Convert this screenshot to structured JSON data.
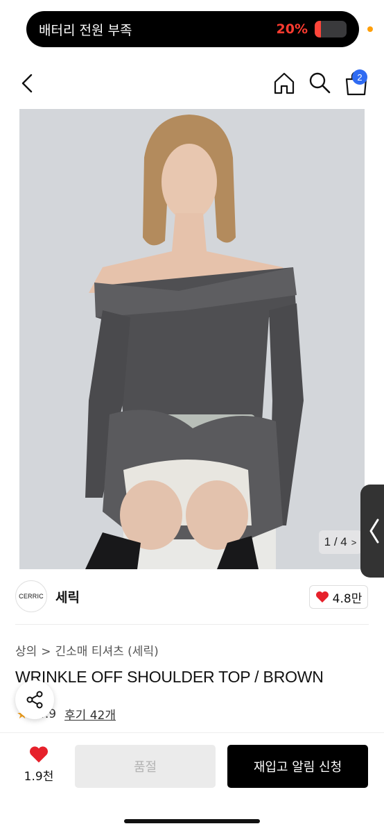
{
  "status": {
    "battery_alert": "배터리 전원 부족",
    "battery_percent": "20%",
    "battery_level": 0.2,
    "alert_color": "#ff3b30"
  },
  "header": {
    "cart_count": "2",
    "icons": [
      "back-arrow-icon",
      "home-icon",
      "search-icon",
      "shopping-bag-icon"
    ],
    "badge_color": "#2f6bf2"
  },
  "gallery": {
    "counter": "1 / 4",
    "current": 1,
    "total": 4
  },
  "brand": {
    "logo_text": "CERRIC",
    "name": "세릭",
    "likes": "4.8만"
  },
  "breadcrumb": [
    "상의",
    "긴소매 티셔츠 (세릭)"
  ],
  "product": {
    "title": "WRINKLE OFF SHOULDER TOP / BROWN",
    "rating": "4.9",
    "reviews": "후기 42개"
  },
  "bottom_bar": {
    "favorite_count": "1.9천",
    "soldout_label": "품절",
    "restock_label": "재입고 알림 신청"
  }
}
